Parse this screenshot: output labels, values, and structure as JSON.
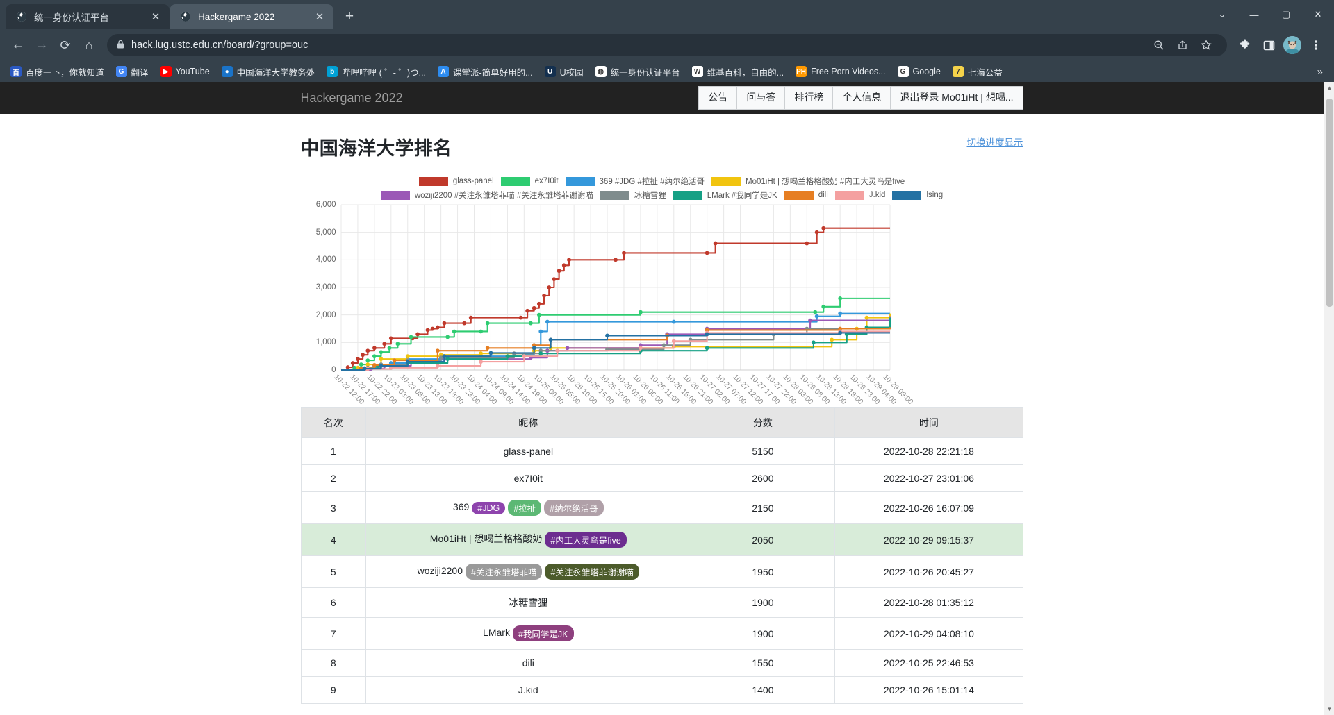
{
  "browser": {
    "tabs": [
      {
        "title": "统一身份认证平台",
        "favicon": "globe-icon",
        "active": false
      },
      {
        "title": "Hackergame 2022",
        "favicon": "globe-icon",
        "active": true
      }
    ],
    "new_tab_label": "+",
    "window_controls": {
      "minimize": "—",
      "maximize": "▢",
      "close": "✕",
      "chevron": "⌄"
    },
    "toolbar": {
      "back": "←",
      "forward": "→",
      "reload": "⟳",
      "home": "⌂",
      "lock_icon": "lock-icon",
      "url": "hack.lug.ustc.edu.cn/board/?group=ouc",
      "zoom_out_icon": "zoom-out-icon",
      "share_icon": "share-icon",
      "bookmark_icon": "star-icon",
      "extensions_icon": "puzzle-icon",
      "sidepanel_icon": "side-panel-icon",
      "profile_icon": "avatar-cat",
      "menu_icon": "three-dot-menu-icon"
    },
    "bookmarks": [
      {
        "label": "百度一下，你就知道",
        "icon": "百",
        "color": "#2b59c3"
      },
      {
        "label": "翻译",
        "icon": "G",
        "color": "#4285f4"
      },
      {
        "label": "YouTube",
        "icon": "▶",
        "color": "#ff0000"
      },
      {
        "label": "中国海洋大学教务处",
        "icon": "●",
        "color": "#1a73c8"
      },
      {
        "label": "哔哩哔哩 ( ゜- ゜)つ...",
        "icon": "b",
        "color": "#00a1d6"
      },
      {
        "label": "课堂派-简单好用的...",
        "icon": "A",
        "color": "#2d8cf0"
      },
      {
        "label": "U校园",
        "icon": "U",
        "color": "#14304f"
      },
      {
        "label": "统一身份认证平台",
        "icon": "◍",
        "color": "#ffffff"
      },
      {
        "label": "维基百科，自由的...",
        "icon": "W",
        "color": "#ffffff"
      },
      {
        "label": "Free Porn Videos...",
        "icon": "PH",
        "color": "#ff9900"
      },
      {
        "label": "Google",
        "icon": "G",
        "color": "#ffffff"
      },
      {
        "label": "七海公益",
        "icon": "7",
        "color": "#f5d34a"
      }
    ],
    "bookmarks_overflow": "»"
  },
  "site": {
    "brand": "Hackergame 2022",
    "nav": [
      {
        "label": "公告"
      },
      {
        "label": "问与答"
      },
      {
        "label": "排行榜"
      },
      {
        "label": "个人信息"
      },
      {
        "label": "退出登录 Mo01iHt | 想喝..."
      }
    ],
    "page_title": "中国海洋大学排名",
    "toggle_link": "切换进度显示"
  },
  "chart_data": {
    "type": "line",
    "title": "中国海洋大学排名",
    "xlabel": "",
    "ylabel": "",
    "ylim": [
      0,
      6000
    ],
    "yticks": [
      0,
      1000,
      2000,
      3000,
      4000,
      5000,
      6000
    ],
    "ytick_labels": [
      "0",
      "1,000",
      "2,000",
      "3,000",
      "4,000",
      "5,000",
      "6,000"
    ],
    "grid": true,
    "legend_position": "top",
    "xtick_labels": [
      "10-22 12:00",
      "10-22 17:00",
      "10-22 22:00",
      "10-23 03:00",
      "10-23 08:00",
      "10-23 13:00",
      "10-23 18:00",
      "10-23 23:00",
      "10-24 04:00",
      "10-24 09:00",
      "10-24 14:00",
      "10-24 19:00",
      "10-25 00:00",
      "10-25 05:00",
      "10-25 10:00",
      "10-25 15:00",
      "10-25 20:00",
      "10-26 01:00",
      "10-26 06:00",
      "10-26 11:00",
      "10-26 16:00",
      "10-26 21:00",
      "10-27 02:00",
      "10-27 07:00",
      "10-27 12:00",
      "10-27 17:00",
      "10-27 22:00",
      "10-28 03:00",
      "10-28 08:00",
      "10-28 13:00",
      "10-28 18:00",
      "10-28 23:00",
      "10-29 04:00",
      "10-29 09:00"
    ],
    "series": [
      {
        "name": "glass-panel",
        "color": "#c0392b",
        "points": [
          [
            0,
            0
          ],
          [
            0.4,
            100
          ],
          [
            0.7,
            250
          ],
          [
            1.0,
            400
          ],
          [
            1.3,
            550
          ],
          [
            1.6,
            700
          ],
          [
            2.0,
            800
          ],
          [
            2.6,
            950
          ],
          [
            3.0,
            1150
          ],
          [
            4.3,
            1150
          ],
          [
            4.6,
            1300
          ],
          [
            5.2,
            1450
          ],
          [
            5.5,
            1500
          ],
          [
            5.8,
            1550
          ],
          [
            6.2,
            1700
          ],
          [
            7.4,
            1700
          ],
          [
            7.8,
            1900
          ],
          [
            10.8,
            1900
          ],
          [
            11.2,
            2150
          ],
          [
            11.6,
            2250
          ],
          [
            11.9,
            2400
          ],
          [
            12.2,
            2700
          ],
          [
            12.5,
            3000
          ],
          [
            12.8,
            3300
          ],
          [
            13.1,
            3600
          ],
          [
            13.4,
            3800
          ],
          [
            13.7,
            4000
          ],
          [
            16.5,
            4000
          ],
          [
            17.0,
            4250
          ],
          [
            22.0,
            4250
          ],
          [
            22.5,
            4600
          ],
          [
            28.0,
            4600
          ],
          [
            28.6,
            5000
          ],
          [
            29.0,
            5150
          ],
          [
            33,
            5150
          ]
        ]
      },
      {
        "name": "ex7I0it",
        "color": "#2ecc71",
        "points": [
          [
            0,
            0
          ],
          [
            0.8,
            80
          ],
          [
            1.2,
            200
          ],
          [
            1.6,
            350
          ],
          [
            2.0,
            500
          ],
          [
            2.4,
            650
          ],
          [
            2.9,
            800
          ],
          [
            3.4,
            950
          ],
          [
            4.2,
            1200
          ],
          [
            6.4,
            1200
          ],
          [
            6.8,
            1400
          ],
          [
            8.4,
            1400
          ],
          [
            8.8,
            1700
          ],
          [
            11.4,
            1700
          ],
          [
            11.9,
            2000
          ],
          [
            18.0,
            2100
          ],
          [
            28.5,
            2100
          ],
          [
            29.0,
            2300
          ],
          [
            30.0,
            2600
          ],
          [
            33,
            2600
          ]
        ]
      },
      {
        "name": "369 #JDG #拉扯 #纳尔绝活哥",
        "color": "#3498db",
        "points": [
          [
            0,
            0
          ],
          [
            1.4,
            60
          ],
          [
            2.0,
            150
          ],
          [
            3.0,
            250
          ],
          [
            4.0,
            400
          ],
          [
            6.0,
            400
          ],
          [
            8.4,
            500
          ],
          [
            11.0,
            560
          ],
          [
            11.6,
            900
          ],
          [
            12.0,
            1400
          ],
          [
            12.4,
            1750
          ],
          [
            20.0,
            1750
          ],
          [
            28.6,
            1950
          ],
          [
            30.0,
            2050
          ],
          [
            33,
            2050
          ]
        ]
      },
      {
        "name": "Mo01iHt | 想喝兰格格酸奶 #内工大灵鸟是five",
        "color": "#f1c40f",
        "points": [
          [
            0,
            0
          ],
          [
            1.0,
            80
          ],
          [
            1.6,
            200
          ],
          [
            2.4,
            400
          ],
          [
            4.0,
            500
          ],
          [
            6.0,
            550
          ],
          [
            8.4,
            600
          ],
          [
            11.6,
            700
          ],
          [
            12.6,
            800
          ],
          [
            20.0,
            850
          ],
          [
            29.5,
            1100
          ],
          [
            31.0,
            1500
          ],
          [
            31.6,
            1900
          ],
          [
            33,
            2050
          ]
        ]
      },
      {
        "name": "woziji2200 #关注永雏塔菲喵 #关注永雏塔菲谢谢喵",
        "color": "#9b59b6",
        "points": [
          [
            0,
            0
          ],
          [
            1.8,
            50
          ],
          [
            2.6,
            150
          ],
          [
            4.2,
            300
          ],
          [
            6.2,
            400
          ],
          [
            11.4,
            450
          ],
          [
            12.4,
            700
          ],
          [
            13.6,
            800
          ],
          [
            18.0,
            900
          ],
          [
            19.6,
            1300
          ],
          [
            22.0,
            1500
          ],
          [
            28.2,
            1800
          ],
          [
            33,
            1950
          ]
        ]
      },
      {
        "name": "冰糖雪狸",
        "color": "#7f8c8d",
        "points": [
          [
            0,
            0
          ],
          [
            1.6,
            80
          ],
          [
            2.4,
            200
          ],
          [
            4.0,
            350
          ],
          [
            6.0,
            450
          ],
          [
            10.4,
            600
          ],
          [
            12.0,
            700
          ],
          [
            16.0,
            750
          ],
          [
            19.4,
            900
          ],
          [
            21.0,
            1100
          ],
          [
            26.0,
            1300
          ],
          [
            28.0,
            1500
          ],
          [
            33,
            1900
          ]
        ]
      },
      {
        "name": "LMark #我同学是JK",
        "color": "#16a085",
        "points": [
          [
            0,
            0
          ],
          [
            1.4,
            60
          ],
          [
            2.2,
            150
          ],
          [
            4.0,
            250
          ],
          [
            6.4,
            400
          ],
          [
            10.0,
            500
          ],
          [
            12.0,
            600
          ],
          [
            18.0,
            700
          ],
          [
            22.0,
            800
          ],
          [
            28.4,
            1000
          ],
          [
            30.4,
            1300
          ],
          [
            31.6,
            1550
          ],
          [
            33,
            1900
          ]
        ]
      },
      {
        "name": "dili",
        "color": "#e67e22",
        "points": [
          [
            0,
            0
          ],
          [
            1.2,
            60
          ],
          [
            2.0,
            180
          ],
          [
            3.2,
            350
          ],
          [
            5.8,
            700
          ],
          [
            8.8,
            800
          ],
          [
            11.6,
            900
          ],
          [
            12.6,
            1100
          ],
          [
            19.6,
            1250
          ],
          [
            22.0,
            1450
          ],
          [
            30.0,
            1500
          ],
          [
            33,
            1550
          ]
        ]
      },
      {
        "name": "J.kid",
        "color": "#f4a0a0",
        "points": [
          [
            0,
            0
          ],
          [
            1.6,
            40
          ],
          [
            3.0,
            80
          ],
          [
            5.8,
            150
          ],
          [
            8.4,
            300
          ],
          [
            11.0,
            500
          ],
          [
            13.0,
            700
          ],
          [
            18.0,
            800
          ],
          [
            20.0,
            1050
          ],
          [
            22.0,
            1350
          ],
          [
            30.0,
            1400
          ],
          [
            33,
            1400
          ]
        ]
      },
      {
        "name": "lsing",
        "color": "#2471a3",
        "points": [
          [
            0,
            0
          ],
          [
            1.4,
            50
          ],
          [
            2.4,
            150
          ],
          [
            4.0,
            300
          ],
          [
            6.2,
            500
          ],
          [
            9.0,
            620
          ],
          [
            11.6,
            800
          ],
          [
            12.6,
            1100
          ],
          [
            16.0,
            1250
          ],
          [
            22.0,
            1300
          ],
          [
            30.0,
            1350
          ],
          [
            33,
            1350
          ]
        ]
      }
    ]
  },
  "table": {
    "columns": [
      "名次",
      "昵称",
      "分数",
      "时间"
    ],
    "rows": [
      {
        "rank": "1",
        "nick": "glass-panel",
        "badges": [],
        "score": "5150",
        "time": "2022-10-28 22:21:18",
        "highlight": false
      },
      {
        "rank": "2",
        "nick": "ex7I0it",
        "badges": [],
        "score": "2600",
        "time": "2022-10-27 23:01:06",
        "highlight": false
      },
      {
        "rank": "3",
        "nick": "369",
        "badges": [
          {
            "text": "#JDG",
            "color": "#8e44ad"
          },
          {
            "text": "#拉扯",
            "color": "#5cb874"
          },
          {
            "text": "#纳尔绝活哥",
            "color": "#b0a0a8"
          }
        ],
        "score": "2150",
        "time": "2022-10-26 16:07:09",
        "highlight": false
      },
      {
        "rank": "4",
        "nick": "Mo01iHt | 想喝兰格格酸奶",
        "badges": [
          {
            "text": "#内工大灵鸟是five",
            "color": "#6c2d8f"
          }
        ],
        "score": "2050",
        "time": "2022-10-29 09:15:37",
        "highlight": true
      },
      {
        "rank": "5",
        "nick": "woziji2200",
        "badges": [
          {
            "text": "#关注永雏塔菲喵",
            "color": "#9a9a9a"
          },
          {
            "text": "#关注永雏塔菲谢谢喵",
            "color": "#4c5b2b"
          }
        ],
        "score": "1950",
        "time": "2022-10-26 20:45:27",
        "highlight": false
      },
      {
        "rank": "6",
        "nick": "冰糖雪狸",
        "badges": [],
        "score": "1900",
        "time": "2022-10-28 01:35:12",
        "highlight": false
      },
      {
        "rank": "7",
        "nick": "LMark",
        "badges": [
          {
            "text": "#我同学是JK",
            "color": "#8e3f7e"
          }
        ],
        "score": "1900",
        "time": "2022-10-29 04:08:10",
        "highlight": false
      },
      {
        "rank": "8",
        "nick": "dili",
        "badges": [],
        "score": "1550",
        "time": "2022-10-25 22:46:53",
        "highlight": false
      },
      {
        "rank": "9",
        "nick": "J.kid",
        "badges": [],
        "score": "1400",
        "time": "2022-10-26 15:01:14",
        "highlight": false
      }
    ]
  }
}
